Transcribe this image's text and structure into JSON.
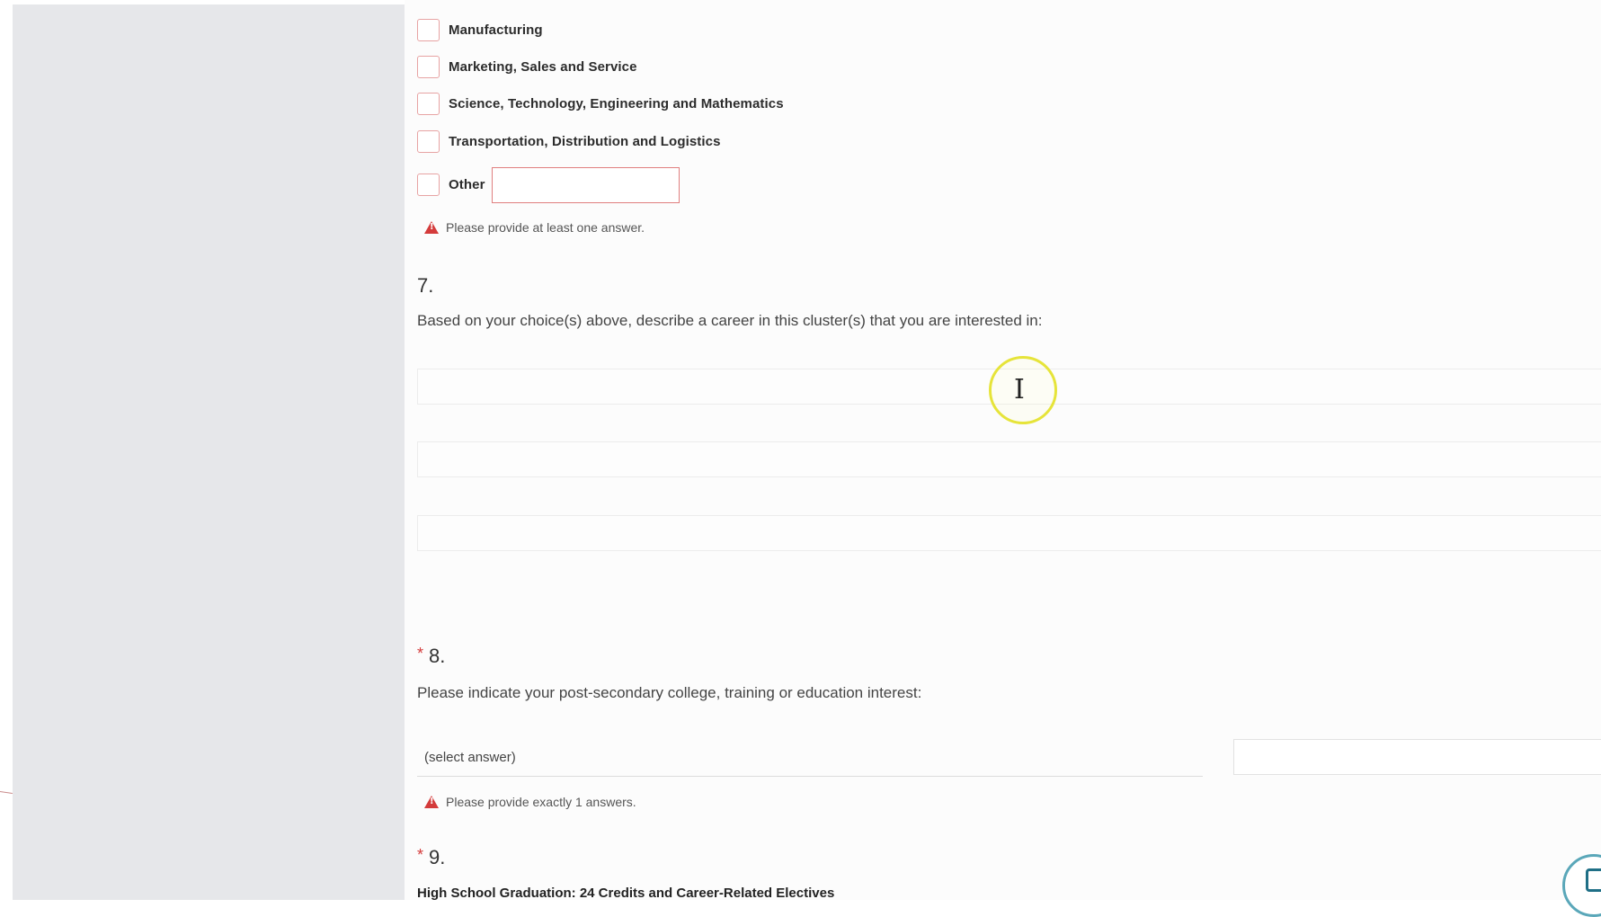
{
  "career_clusters": {
    "options": [
      {
        "label": "Manufacturing"
      },
      {
        "label": "Marketing, Sales and Service"
      },
      {
        "label": "Science, Technology, Engineering and Mathematics"
      },
      {
        "label": "Transportation, Distribution and Logistics"
      },
      {
        "label": "Other"
      }
    ],
    "error": "Please provide at least one answer."
  },
  "q7": {
    "number": "7.",
    "text": "Based on your choice(s) above, describe a career in this cluster(s) that you are interested in:"
  },
  "q8": {
    "required_mark": "*",
    "number": "8.",
    "text": "Please indicate your post-secondary college, training or education interest:",
    "select_value": "(select answer)",
    "error": "Please provide exactly 1 answers."
  },
  "q9": {
    "required_mark": "*",
    "number": "9.",
    "title": "High School Graduation: 24 Credits and Career-Related Electives"
  },
  "colors": {
    "error_red": "#d43b3b",
    "checkbox_border": "#e7a3a3",
    "sidebar_bg": "#e6e7ea",
    "cursor_highlight": "#e6e43a"
  }
}
